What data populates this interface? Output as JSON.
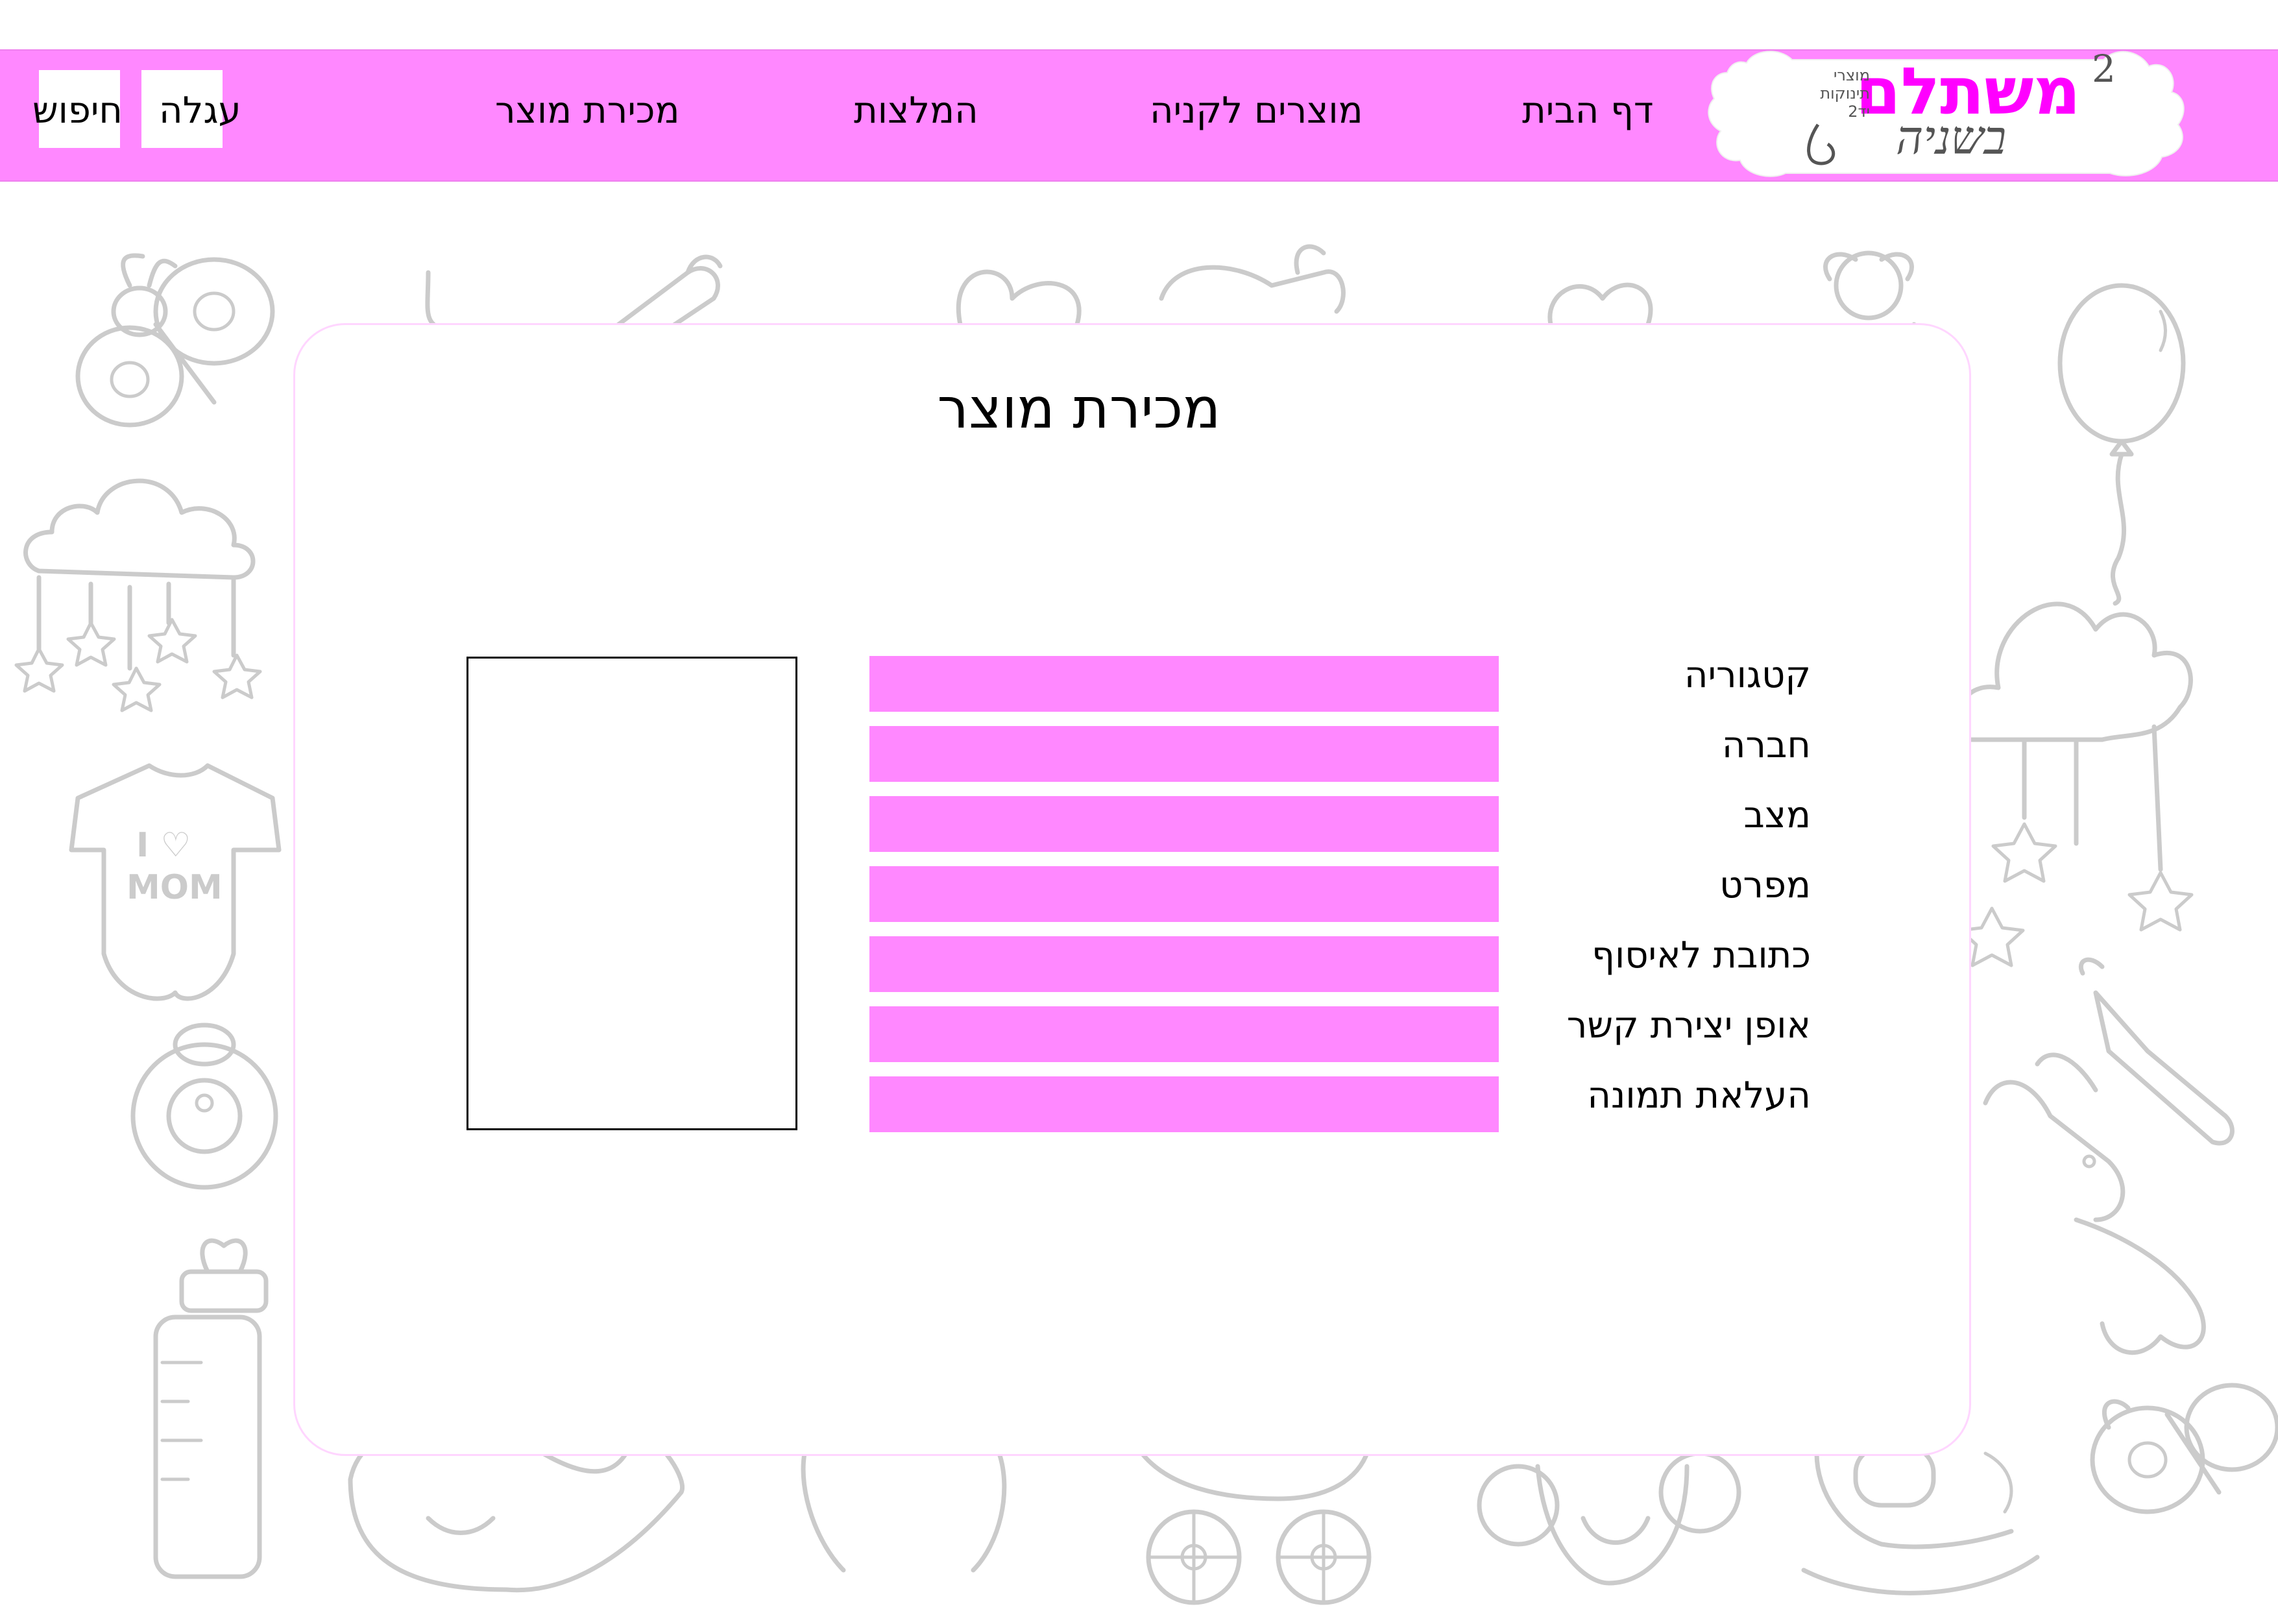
{
  "header": {
    "logo": {
      "brand": "משתלם",
      "superscript": "2",
      "tagline": "בשניה",
      "side_text": [
        "מוצרי",
        "תינוקות",
        "יד2"
      ]
    },
    "nav": {
      "home": "דף הבית",
      "products_for_sale": "מוצרים לקניה",
      "recommendations": "המלצות",
      "sell_product": "מכירת מוצר",
      "cart": "עגלה",
      "search": "חיפוש"
    }
  },
  "form": {
    "title": "מכירת מוצר",
    "fields": [
      {
        "label": "קטגוריה",
        "value": ""
      },
      {
        "label": "חברה",
        "value": ""
      },
      {
        "label": "מצב",
        "value": ""
      },
      {
        "label": "מפרט",
        "value": ""
      },
      {
        "label": "כתובת לאיסוף",
        "value": ""
      },
      {
        "label": "אופן יצירת קשר",
        "value": ""
      },
      {
        "label": "העלאת תמונה",
        "value": ""
      }
    ]
  },
  "colors": {
    "accent": "#ff88ff",
    "logo_magenta": "#ff00ff",
    "background_doodle": "#cbcbcb"
  },
  "background": {
    "doodle_text": "I ♡ MOM"
  }
}
